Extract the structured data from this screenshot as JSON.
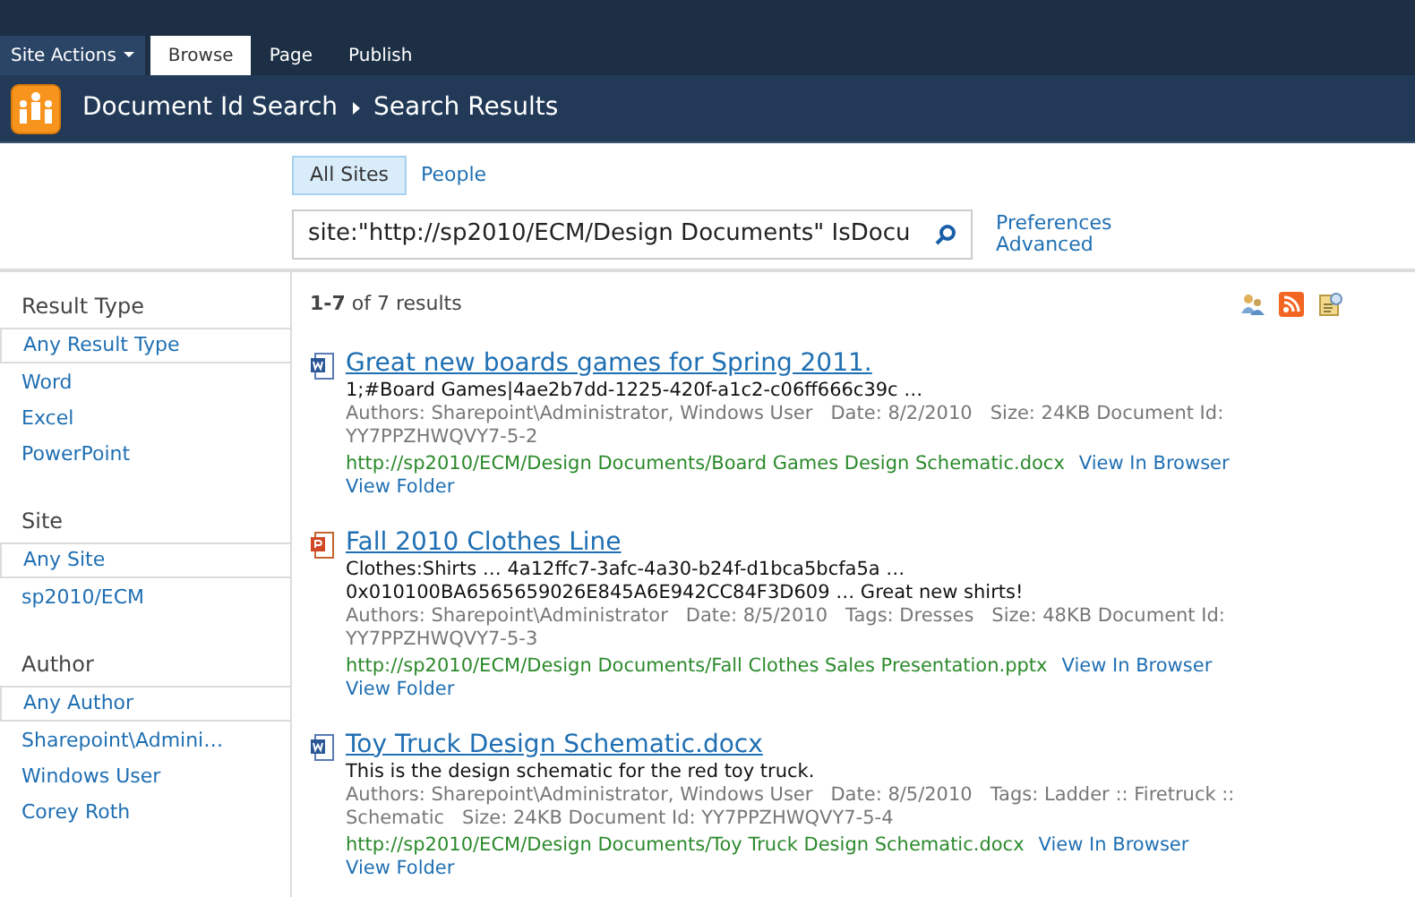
{
  "ribbon": {
    "site_actions": "Site Actions",
    "tabs": [
      {
        "label": "Browse",
        "selected": true
      },
      {
        "label": "Page",
        "selected": false
      },
      {
        "label": "Publish",
        "selected": false
      }
    ]
  },
  "breadcrumb": [
    "Document Id Search",
    "Search Results"
  ],
  "scopes": [
    {
      "label": "All Sites",
      "selected": true
    },
    {
      "label": "People",
      "selected": false
    }
  ],
  "search": {
    "value": "site:\"http://sp2010/ECM/Design Documents\" IsDocu"
  },
  "search_links": [
    "Preferences",
    "Advanced"
  ],
  "refiners": [
    {
      "heading": "Result Type",
      "items": [
        {
          "label": "Any Result Type",
          "selected": true
        },
        {
          "label": "Word",
          "selected": false
        },
        {
          "label": "Excel",
          "selected": false
        },
        {
          "label": "PowerPoint",
          "selected": false
        }
      ]
    },
    {
      "heading": "Site",
      "items": [
        {
          "label": "Any Site",
          "selected": true
        },
        {
          "label": "sp2010/ECM",
          "selected": false
        }
      ]
    },
    {
      "heading": "Author",
      "items": [
        {
          "label": "Any Author",
          "selected": true
        },
        {
          "label": "Sharepoint\\Admini…",
          "selected": false
        },
        {
          "label": "Windows User",
          "selected": false
        },
        {
          "label": "Corey Roth",
          "selected": false
        }
      ]
    }
  ],
  "result_count": "**1-7** of 7 results",
  "results": [
    {
      "kind": "word",
      "title": "Great new boards games for Spring 2011.",
      "description": "1;#Board Games|4ae2b7dd-1225-420f-a1c2-c06ff666c39c …",
      "meta": "Authors: Sharepoint\\Administrator, Windows User   Date: 8/2/2010   Size: 24KB Document Id: YY7PPZHWQVY7-5-2",
      "url": "http://sp2010/ECM/Design Documents/Board Games Design Schematic.docx",
      "actions": [
        "View In Browser",
        "View Folder"
      ]
    },
    {
      "kind": "powerpoint",
      "title": "Fall 2010 Clothes Line",
      "description": "Clothes:Shirts … 4a12ffc7-3afc-4a30-b24f-d1bca5bcfa5a … 0x010100BA6565659026E845A6E942CC84F3D609 … Great new shirts!",
      "meta": "Authors: Sharepoint\\Administrator   Date: 8/5/2010   Tags: Dresses   Size: 48KB Document Id: YY7PPZHWQVY7-5-3",
      "url": "http://sp2010/ECM/Design Documents/Fall Clothes Sales Presentation.pptx",
      "actions": [
        "View In Browser",
        "View Folder"
      ]
    },
    {
      "kind": "word",
      "title": "Toy Truck Design Schematic.docx",
      "description": "This is the design schematic for the red toy truck.",
      "meta": "Authors: Sharepoint\\Administrator, Windows User   Date: 8/5/2010   Tags: Ladder :: Firetruck :: Schematic   Size: 24KB Document Id: YY7PPZHWQVY7-5-4",
      "url": "http://sp2010/ECM/Design Documents/Toy Truck Design Schematic.docx",
      "actions": [
        "View In Browser",
        "View Folder"
      ]
    }
  ]
}
